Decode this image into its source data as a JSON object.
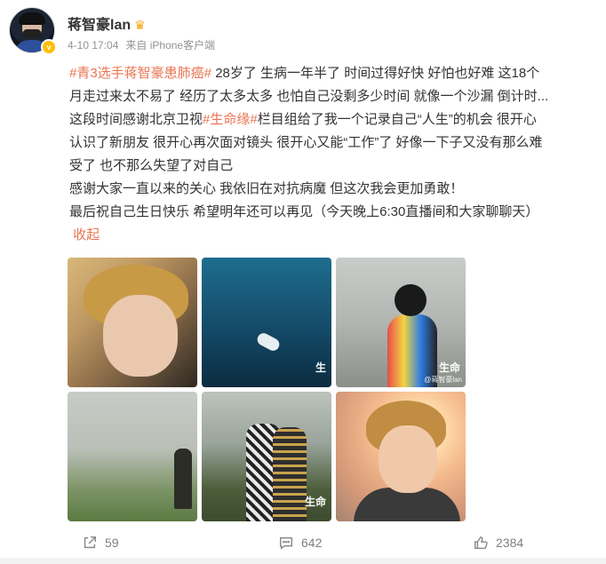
{
  "post": {
    "author": "蒋智豪lan",
    "time": "4-10 17:04",
    "source": "来自 iPhone客户端",
    "lines": [
      {
        "hashtag": "#青3选手蒋智豪患肺癌#",
        "text": " 28岁了 生病一年半了 时间过得好快 好怕也好难 这18个"
      },
      {
        "text": "月走过来太不易了 经历了太多太多 也怕自己没剩多少时间 就像一个沙漏 倒计时..."
      },
      {
        "pre": "这段时间感谢北京卫视",
        "hashtag": "#生命缘#",
        "text": "栏目组给了我一个记录自己“人生”的机会 很开心"
      },
      {
        "text": "认识了新朋友 很开心再次面对镜头 很开心又能“工作”了 好像一下子又没有那么难"
      },
      {
        "text": "受了 也不那么失望了对自己"
      },
      {
        "text": "感谢大家一直以来的关心 我依旧在对抗病魔 但这次我会更加勇敢！"
      },
      {
        "text": "最后祝自己生日快乐 希望明年还可以再见（今天晚上6:30直播间和大家聊聊天）"
      }
    ],
    "collapse": "收起",
    "watermarks": {
      "t2": "生",
      "t3": "生命",
      "t3_small": "@蒋智豪lan",
      "t5": "生命"
    }
  },
  "actions": {
    "share_count": "59",
    "comment_count": "642",
    "like_count": "2384"
  },
  "icons": [
    "share-icon",
    "comment-icon",
    "like-icon",
    "verified-icon",
    "crown-icon"
  ],
  "colors": {
    "hashtag": "#eb7350",
    "meta": "#939393",
    "action": "#808080"
  }
}
